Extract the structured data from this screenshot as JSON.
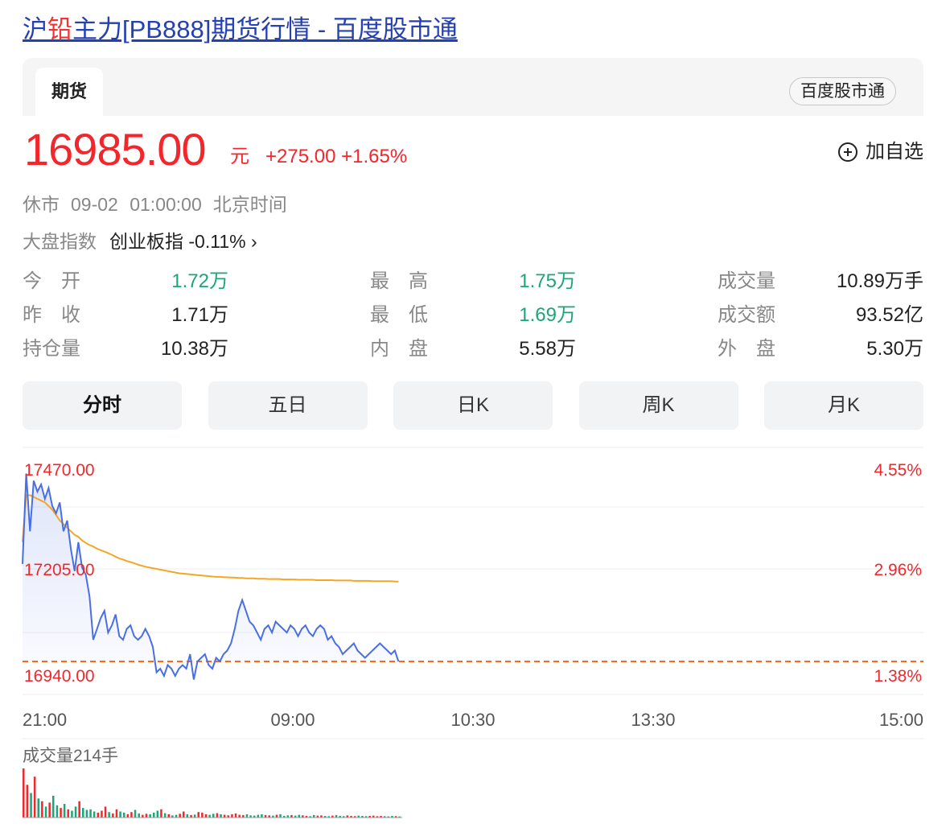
{
  "page": {
    "title_prefix": "沪",
    "title_highlight": "铅",
    "title_rest": "主力[PB888]期货行情 - 百度股市通"
  },
  "tabs": {
    "active_label": "期货",
    "source_badge": "百度股市通"
  },
  "quote": {
    "price": "16985.00",
    "unit": "元",
    "change": "+275.00 +1.65%",
    "add_watch": "加自选",
    "status": "休市",
    "datetime": "09-02 01:00:00",
    "timezone": "北京时间",
    "index_label": "大盘指数",
    "index_link": "创业板指 -0.11% ›"
  },
  "stats": {
    "open_label": "今　开",
    "open_value": "1.72万",
    "high_label": "最　高",
    "high_value": "1.75万",
    "volume_label": "成交量",
    "volume_value": "10.89万手",
    "prev_close_label": "昨　收",
    "prev_close_value": "1.71万",
    "low_label": "最　低",
    "low_value": "1.69万",
    "turnover_label": "成交额",
    "turnover_value": "93.52亿",
    "open_interest_label": "持仓量",
    "open_interest_value": "10.38万",
    "inner_label": "内　盘",
    "inner_value": "5.58万",
    "outer_label": "外　盘",
    "outer_value": "5.30万"
  },
  "periods": [
    "分时",
    "五日",
    "日K",
    "周K",
    "月K"
  ],
  "colors": {
    "price_line": "#4a6fe3",
    "avg_line": "#f5a623",
    "up": "#f2272c",
    "down": "#1ca577",
    "prev_close_line": "#f26b21"
  },
  "chart_data": {
    "type": "line",
    "y_labels": [
      "17470.00",
      "17205.00",
      "16940.00"
    ],
    "pct_labels": [
      "4.55%",
      "2.96%",
      "1.38%"
    ],
    "x_labels": [
      "21:00",
      "09:00",
      "10:30",
      "13:30",
      "15:00"
    ],
    "ylim": [
      16940,
      17470
    ],
    "prev_close": 16940,
    "volume_label": "成交量214手",
    "series": [
      {
        "values": [
          17210,
          17460,
          17300,
          17440,
          17410,
          17430,
          17390,
          17420,
          17370,
          17350,
          17380,
          17300,
          17330,
          17250,
          17190,
          17270,
          17200,
          17180,
          17120,
          17000,
          17030,
          17060,
          17080,
          17020,
          17040,
          17070,
          17010,
          17000,
          17030,
          17040,
          17010,
          17000,
          17010,
          17030,
          17010,
          16980,
          16910,
          16920,
          16900,
          16930,
          16920,
          16900,
          16920,
          16930,
          16920,
          16960,
          16890,
          16940,
          16950,
          16960,
          16930,
          16920,
          16950,
          16940,
          16960,
          16970,
          16990,
          17030,
          17080,
          17110,
          17080,
          17050,
          17040,
          17020,
          17000,
          17030,
          17040,
          17020,
          17050,
          17040,
          17030,
          17020,
          17040,
          17030,
          17010,
          17030,
          17040,
          17020,
          17010,
          17030,
          17040,
          17030,
          17000,
          17010,
          16990,
          16980,
          16960,
          16970,
          16980,
          16990,
          16970,
          16960,
          16950,
          16960,
          16970,
          16980,
          16990,
          16980,
          16970,
          16960,
          16970,
          16940
        ]
      },
      {
        "values": [
          17270,
          17400,
          17400,
          17395,
          17390,
          17385,
          17380,
          17370,
          17360,
          17345,
          17330,
          17320,
          17310,
          17300,
          17290,
          17285,
          17275,
          17268,
          17262,
          17258,
          17252,
          17248,
          17244,
          17240,
          17235,
          17230,
          17225,
          17222,
          17218,
          17215,
          17212,
          17208,
          17205,
          17202,
          17200,
          17198,
          17196,
          17194,
          17192,
          17190,
          17188,
          17186,
          17184,
          17183,
          17182,
          17181,
          17180,
          17179,
          17178,
          17177,
          17176,
          17175,
          17174,
          17174,
          17173,
          17173,
          17172,
          17172,
          17171,
          17171,
          17170,
          17170,
          17170,
          17169,
          17169,
          17169,
          17168,
          17168,
          17168,
          17168,
          17167,
          17167,
          17167,
          17167,
          17166,
          17166,
          17166,
          17166,
          17166,
          17165,
          17165,
          17165,
          17165,
          17165,
          17164,
          17164,
          17164,
          17164,
          17164,
          17163,
          17163,
          17163,
          17163,
          17163,
          17162,
          17162,
          17162,
          17162,
          17162,
          17162,
          17161,
          17161
        ]
      }
    ],
    "volume": [
      180,
      120,
      90,
      150,
      70,
      60,
      40,
      55,
      80,
      45,
      35,
      50,
      30,
      25,
      40,
      60,
      35,
      28,
      30,
      22,
      18,
      25,
      40,
      20,
      15,
      30,
      22,
      18,
      12,
      20,
      28,
      15,
      10,
      14,
      12,
      18,
      25,
      30,
      16,
      12,
      8,
      10,
      14,
      22,
      12,
      9,
      11,
      20,
      18,
      12,
      10,
      14,
      16,
      12,
      10,
      8,
      12,
      15,
      10,
      9,
      12,
      8,
      7,
      10,
      12,
      9,
      8,
      7,
      10,
      12,
      6,
      8,
      9,
      7,
      10,
      8,
      6,
      5,
      9,
      7,
      8,
      6,
      5,
      7,
      9,
      6,
      5,
      8,
      6,
      5,
      7,
      6,
      5,
      6,
      7,
      5,
      6,
      5,
      4,
      6,
      5,
      4
    ]
  }
}
